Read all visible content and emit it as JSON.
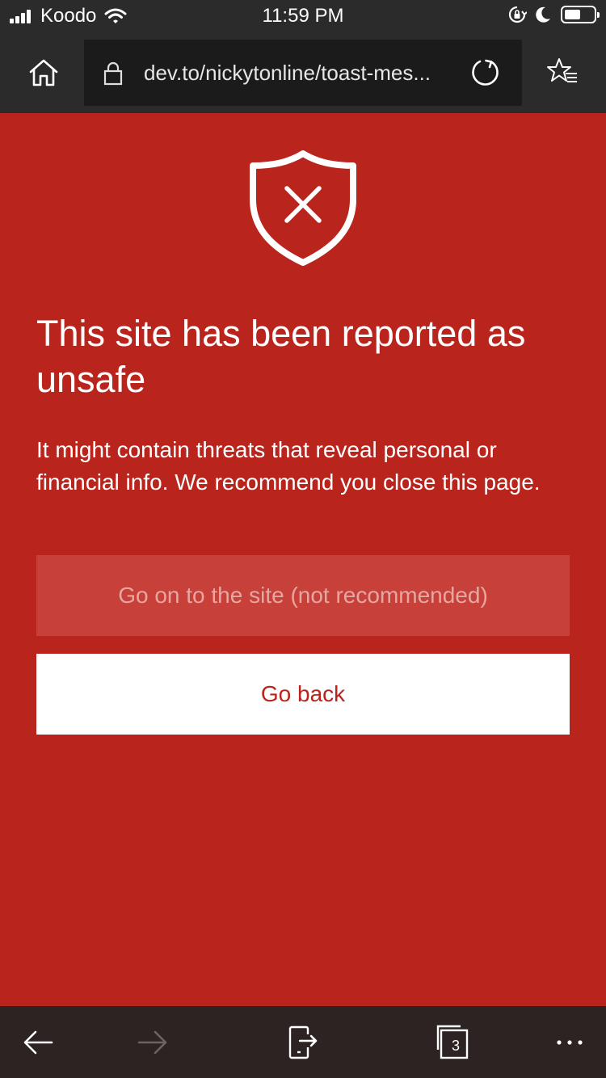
{
  "status_bar": {
    "carrier": "Koodo",
    "time": "11:59 PM"
  },
  "toolbar": {
    "url": "dev.to/nickytonline/toast-mes..."
  },
  "warning": {
    "title": "This site has been reported as unsafe",
    "description": "It might contain threats that reveal personal or financial info. We recommend you close this page.",
    "proceed_label": "Go on to the site (not recommended)",
    "back_label": "Go back"
  },
  "bottom_bar": {
    "tab_count": "3"
  },
  "colors": {
    "accent_red": "#b9241c",
    "toolbar": "#2b2b2b",
    "bottom_bar": "#2d2323"
  },
  "icons": [
    "home-icon",
    "lock-icon",
    "reload-icon",
    "favorites-icon",
    "shield-x-icon",
    "back-arrow-icon",
    "forward-arrow-icon",
    "share-icon",
    "tabs-icon",
    "more-icon"
  ]
}
